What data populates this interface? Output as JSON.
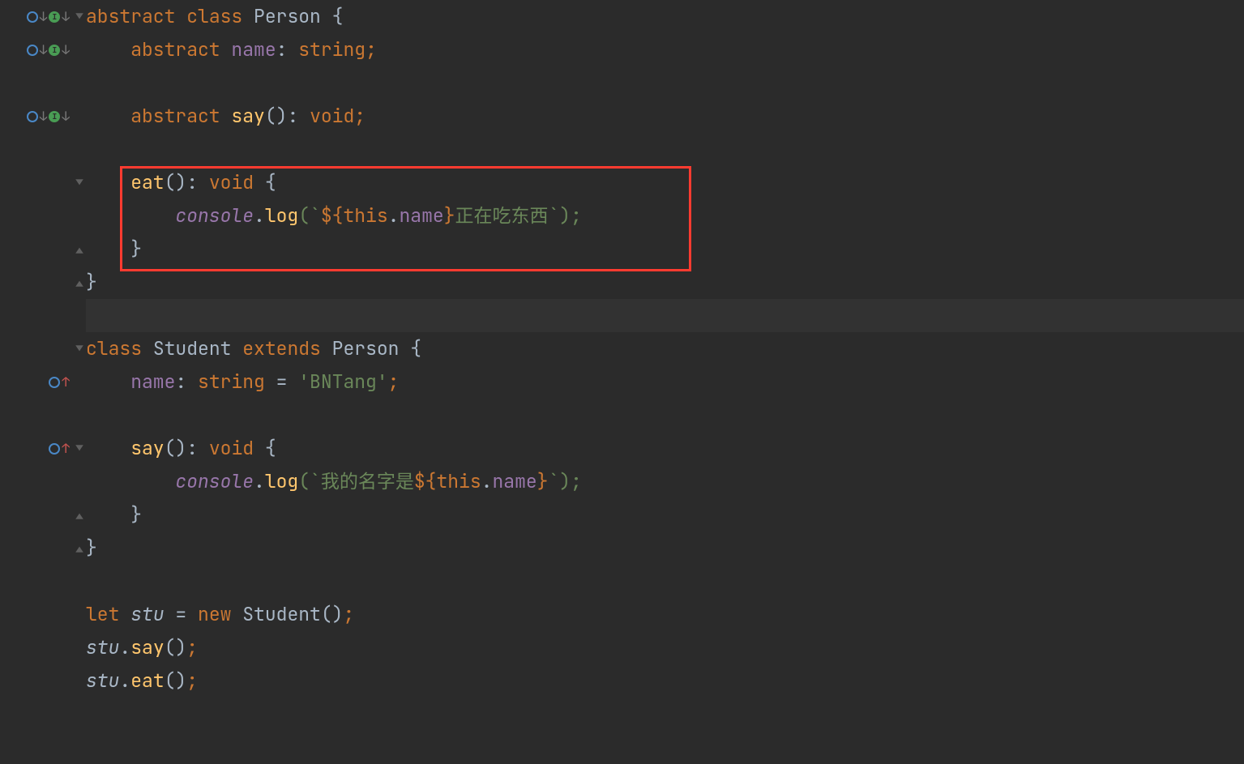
{
  "code": {
    "l1": {
      "kw1": "abstract",
      "kw2": "class",
      "cls": "Person",
      "br": "{"
    },
    "l2": {
      "kw": "abstract",
      "name": "name",
      "colon": ":",
      "type": "string",
      "semi": ";"
    },
    "l4": {
      "kw": "abstract",
      "fn": "say",
      "paren": "()",
      "colon": ":",
      "type": "void",
      "semi": ";"
    },
    "l6": {
      "fn": "eat",
      "paren": "()",
      "colon": ":",
      "type": "void",
      "br": "{"
    },
    "l7": {
      "obj": "console",
      "dot": ".",
      "m": "log",
      "op": "(`",
      "tpl1": "${",
      "this": "this",
      "dot2": ".",
      "prop": "name",
      "tpl2": "}",
      "txt": "正在吃东西",
      "cl": "`);",
      "semi": ""
    },
    "l8": {
      "br": "}"
    },
    "l9": {
      "br": "}"
    },
    "l11": {
      "kw": "class",
      "cls": "Student",
      "ext": "extends",
      "sup": "Person",
      "br": "{"
    },
    "l12": {
      "name": "name",
      "colon": ":",
      "type": "string",
      "eq": " = ",
      "str": "'BNTang'",
      "semi": ";"
    },
    "l14": {
      "fn": "say",
      "paren": "()",
      "colon": ":",
      "type": "void",
      "br": "{"
    },
    "l15": {
      "obj": "console",
      "dot": ".",
      "m": "log",
      "op": "(`",
      "txt": "我的名字是",
      "tpl1": "${",
      "this": "this",
      "dot2": ".",
      "prop": "name",
      "tpl2": "}",
      "cl": "`);",
      "semi": ""
    },
    "l16": {
      "br": "}"
    },
    "l17": {
      "br": "}"
    },
    "l19": {
      "kw": "let",
      "var": "stu",
      "eq": " = ",
      "nw": "new",
      "cls": "Student",
      "paren": "()",
      "semi": ";"
    },
    "l20": {
      "var": "stu",
      "dot": ".",
      "m": "say",
      "paren": "()",
      "semi": ";"
    },
    "l21": {
      "var": "stu",
      "dot": ".",
      "m": "eat",
      "paren": "()",
      "semi": ";"
    }
  },
  "icons": {
    "interface": "O",
    "implement": "I",
    "arrow_down": "↓",
    "arrow_up": "↑"
  }
}
